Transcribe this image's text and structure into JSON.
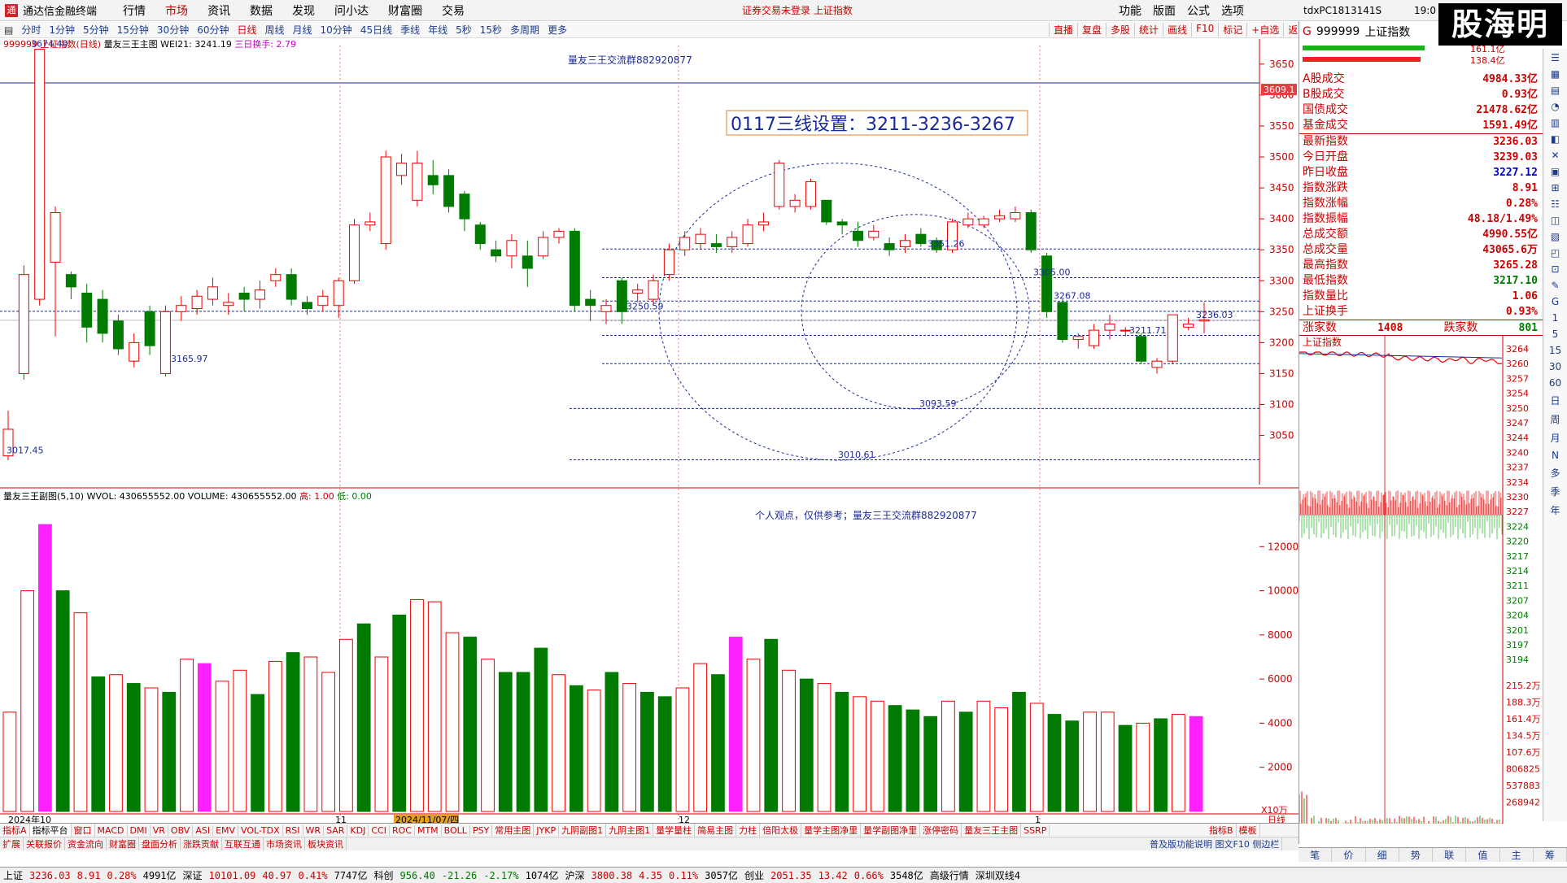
{
  "app": {
    "title": "通达信金融终端",
    "notice": "证券交易未登录  上证指数",
    "pc_name": "tdxPC1813141S",
    "clock": "19:0",
    "brand": "股海明灯"
  },
  "menu": [
    {
      "label": "行情"
    },
    {
      "label": "市场",
      "active": true
    },
    {
      "label": "资讯"
    },
    {
      "label": "数据"
    },
    {
      "label": "发现"
    },
    {
      "label": "问小达"
    },
    {
      "label": "财富圈"
    },
    {
      "label": "交易"
    }
  ],
  "menu_right": [
    "功能",
    "版面",
    "公式",
    "选项"
  ],
  "periods": [
    "分时",
    "1分钟",
    "5分钟",
    "15分钟",
    "30分钟",
    "60分钟",
    "日线",
    "周线",
    "月线",
    "10分钟",
    "45日线",
    "季线",
    "年线",
    "5秒",
    "15秒",
    "多周期",
    "更多"
  ],
  "period_active": "日线",
  "tools": [
    "直播",
    "复盘",
    "多股",
    "统计",
    "画线",
    "F10",
    "标记",
    "+自选",
    "返回"
  ],
  "chart_header": {
    "name": "999999 上证指数(日线)",
    "ind": "量友三王主图",
    "wei": "WEI21: 3241.19",
    "swap": "三日换手: 2.79"
  },
  "annotation_top": "量友三王交流群882920877",
  "boxed_text": "0117三线设置：3211-3236-3267",
  "vol_header": {
    "name": "量友三王副图(5,10)",
    "wvol": "WVOL: 430655552.00",
    "volume": "VOLUME: 430655552.00",
    "high": "高: 1.00",
    "low": "低: 0.00"
  },
  "vol_note": "个人观点，仅供参考；量友三王交流群882920877",
  "price_labels": [
    "3674.40",
    "3017.45",
    "3165.97",
    "3250.59",
    "3351.26",
    "3305.00",
    "3267.08",
    "3211.71",
    "3236.03",
    "3093.59",
    "3010.61"
  ],
  "price_tag": "3609.1",
  "y_ticks": [
    "3650",
    "3600",
    "3550",
    "3500",
    "3450",
    "3400",
    "3350",
    "3300",
    "3250",
    "3200",
    "3150",
    "3100",
    "3050"
  ],
  "vol_ticks": [
    "12000",
    "10000",
    "8000",
    "6000",
    "4000",
    "2000"
  ],
  "vol_unit": "X10万",
  "x_labels": [
    "2024年10",
    "11",
    "2024/11/07/四",
    "12",
    "1"
  ],
  "x_label_right": "日线",
  "chart_data": {
    "type": "candlestick",
    "ylim": [
      3010,
      3680
    ],
    "candles": [
      [
        3017,
        3060,
        3010,
        3090
      ],
      [
        3150,
        3310,
        3140,
        3325
      ],
      [
        3270,
        3674,
        3260,
        3674
      ],
      [
        3330,
        3410,
        3210,
        3420
      ],
      [
        3310,
        3290,
        3270,
        3315
      ],
      [
        3280,
        3225,
        3200,
        3295
      ],
      [
        3270,
        3215,
        3200,
        3285
      ],
      [
        3235,
        3190,
        3180,
        3245
      ],
      [
        3170,
        3200,
        3160,
        3215
      ],
      [
        3250,
        3195,
        3180,
        3260
      ],
      [
        3150,
        3250,
        3145,
        3260
      ],
      [
        3250,
        3260,
        3235,
        3275
      ],
      [
        3255,
        3275,
        3245,
        3285
      ],
      [
        3270,
        3290,
        3260,
        3305
      ],
      [
        3260,
        3265,
        3245,
        3280
      ],
      [
        3280,
        3270,
        3250,
        3290
      ],
      [
        3270,
        3285,
        3255,
        3300
      ],
      [
        3300,
        3310,
        3290,
        3320
      ],
      [
        3310,
        3270,
        3260,
        3320
      ],
      [
        3265,
        3255,
        3245,
        3275
      ],
      [
        3260,
        3275,
        3250,
        3285
      ],
      [
        3260,
        3300,
        3240,
        3305
      ],
      [
        3300,
        3390,
        3295,
        3400
      ],
      [
        3390,
        3395,
        3380,
        3410
      ],
      [
        3360,
        3500,
        3350,
        3510
      ],
      [
        3470,
        3490,
        3455,
        3505
      ],
      [
        3430,
        3490,
        3420,
        3510
      ],
      [
        3470,
        3455,
        3440,
        3495
      ],
      [
        3470,
        3420,
        3410,
        3480
      ],
      [
        3440,
        3400,
        3380,
        3445
      ],
      [
        3390,
        3360,
        3350,
        3395
      ],
      [
        3350,
        3340,
        3330,
        3365
      ],
      [
        3340,
        3365,
        3320,
        3375
      ],
      [
        3340,
        3320,
        3290,
        3365
      ],
      [
        3340,
        3370,
        3335,
        3380
      ],
      [
        3370,
        3380,
        3360,
        3385
      ],
      [
        3380,
        3260,
        3250,
        3385
      ],
      [
        3270,
        3260,
        3235,
        3285
      ],
      [
        3250,
        3260,
        3230,
        3270
      ],
      [
        3300,
        3250,
        3230,
        3305
      ],
      [
        3280,
        3285,
        3265,
        3295
      ],
      [
        3270,
        3300,
        3260,
        3310
      ],
      [
        3310,
        3350,
        3300,
        3360
      ],
      [
        3350,
        3370,
        3340,
        3380
      ],
      [
        3360,
        3375,
        3350,
        3385
      ],
      [
        3360,
        3355,
        3345,
        3375
      ],
      [
        3355,
        3370,
        3345,
        3380
      ],
      [
        3360,
        3390,
        3355,
        3400
      ],
      [
        3390,
        3395,
        3380,
        3410
      ],
      [
        3420,
        3490,
        3415,
        3495
      ],
      [
        3420,
        3430,
        3410,
        3440
      ],
      [
        3420,
        3460,
        3415,
        3465
      ],
      [
        3430,
        3395,
        3390,
        3430
      ],
      [
        3395,
        3390,
        3375,
        3400
      ],
      [
        3380,
        3365,
        3355,
        3395
      ],
      [
        3370,
        3380,
        3365,
        3390
      ],
      [
        3360,
        3350,
        3340,
        3370
      ],
      [
        3355,
        3365,
        3345,
        3375
      ],
      [
        3375,
        3360,
        3355,
        3385
      ],
      [
        3365,
        3350,
        3345,
        3370
      ],
      [
        3350,
        3395,
        3345,
        3400
      ],
      [
        3390,
        3400,
        3385,
        3410
      ],
      [
        3390,
        3400,
        3385,
        3405
      ],
      [
        3400,
        3405,
        3395,
        3415
      ],
      [
        3400,
        3410,
        3395,
        3420
      ],
      [
        3410,
        3350,
        3345,
        3415
      ],
      [
        3340,
        3250,
        3240,
        3345
      ],
      [
        3265,
        3205,
        3200,
        3270
      ],
      [
        3205,
        3210,
        3190,
        3215
      ],
      [
        3195,
        3220,
        3190,
        3230
      ],
      [
        3220,
        3230,
        3205,
        3245
      ],
      [
        3220,
        3220,
        3210,
        3225
      ],
      [
        3210,
        3170,
        3165,
        3215
      ],
      [
        3160,
        3170,
        3150,
        3175
      ],
      [
        3170,
        3245,
        3165,
        3245
      ],
      [
        3225,
        3230,
        3220,
        3240
      ],
      [
        3235,
        3237,
        3215,
        3265
      ]
    ],
    "volume": [
      {
        "v": 4500,
        "c": "r"
      },
      {
        "v": 10000,
        "c": "r"
      },
      {
        "v": 13000,
        "c": "m"
      },
      {
        "v": 10000,
        "c": "g"
      },
      {
        "v": 9000,
        "c": "r"
      },
      {
        "v": 6100,
        "c": "g"
      },
      {
        "v": 6200,
        "c": "r"
      },
      {
        "v": 5800,
        "c": "g"
      },
      {
        "v": 5600,
        "c": "r"
      },
      {
        "v": 5400,
        "c": "g"
      },
      {
        "v": 6900,
        "c": "r"
      },
      {
        "v": 6700,
        "c": "m"
      },
      {
        "v": 5900,
        "c": "r"
      },
      {
        "v": 6400,
        "c": "r"
      },
      {
        "v": 5300,
        "c": "g"
      },
      {
        "v": 6800,
        "c": "r"
      },
      {
        "v": 7200,
        "c": "g"
      },
      {
        "v": 7000,
        "c": "r"
      },
      {
        "v": 6300,
        "c": "r"
      },
      {
        "v": 7800,
        "c": "r"
      },
      {
        "v": 8500,
        "c": "g"
      },
      {
        "v": 7000,
        "c": "r"
      },
      {
        "v": 8900,
        "c": "g"
      },
      {
        "v": 9600,
        "c": "r"
      },
      {
        "v": 9500,
        "c": "r"
      },
      {
        "v": 8100,
        "c": "r"
      },
      {
        "v": 7900,
        "c": "g"
      },
      {
        "v": 6900,
        "c": "r"
      },
      {
        "v": 6300,
        "c": "g"
      },
      {
        "v": 6300,
        "c": "g"
      },
      {
        "v": 7400,
        "c": "g"
      },
      {
        "v": 6200,
        "c": "r"
      },
      {
        "v": 5700,
        "c": "g"
      },
      {
        "v": 5500,
        "c": "r"
      },
      {
        "v": 6300,
        "c": "g"
      },
      {
        "v": 5800,
        "c": "r"
      },
      {
        "v": 5400,
        "c": "g"
      },
      {
        "v": 5200,
        "c": "g"
      },
      {
        "v": 5600,
        "c": "r"
      },
      {
        "v": 6700,
        "c": "r"
      },
      {
        "v": 6200,
        "c": "g"
      },
      {
        "v": 7900,
        "c": "m"
      },
      {
        "v": 6900,
        "c": "r"
      },
      {
        "v": 7800,
        "c": "g"
      },
      {
        "v": 6400,
        "c": "r"
      },
      {
        "v": 6000,
        "c": "g"
      },
      {
        "v": 5800,
        "c": "r"
      },
      {
        "v": 5400,
        "c": "g"
      },
      {
        "v": 5200,
        "c": "r"
      },
      {
        "v": 5000,
        "c": "r"
      },
      {
        "v": 4800,
        "c": "g"
      },
      {
        "v": 4600,
        "c": "g"
      },
      {
        "v": 4300,
        "c": "g"
      },
      {
        "v": 5000,
        "c": "r"
      },
      {
        "v": 4500,
        "c": "g"
      },
      {
        "v": 5000,
        "c": "r"
      },
      {
        "v": 4700,
        "c": "r"
      },
      {
        "v": 5400,
        "c": "g"
      },
      {
        "v": 4900,
        "c": "r"
      },
      {
        "v": 4400,
        "c": "g"
      },
      {
        "v": 4100,
        "c": "g"
      },
      {
        "v": 4500,
        "c": "r"
      },
      {
        "v": 4500,
        "c": "r"
      },
      {
        "v": 3900,
        "c": "g"
      },
      {
        "v": 4000,
        "c": "r"
      },
      {
        "v": 4200,
        "c": "g"
      },
      {
        "v": 4400,
        "c": "r"
      },
      {
        "v": 4300,
        "c": "m"
      }
    ],
    "hlines": [
      3351.26,
      3305.0,
      3267.08,
      3250.59,
      3236.03,
      3211.71,
      3165.97,
      3093.59,
      3010.61
    ]
  },
  "right": {
    "code": "999999",
    "name": "上证指数",
    "g": "G",
    "top_vals": [
      "161.1亿",
      "138.4亿"
    ],
    "rows1": [
      {
        "k": "A股成交",
        "v": "4984.33亿"
      },
      {
        "k": "B股成交",
        "v": "0.93亿"
      },
      {
        "k": "国债成交",
        "v": "21478.62亿"
      },
      {
        "k": "基金成交",
        "v": "1591.49亿"
      }
    ],
    "rows2": [
      {
        "k": "最新指数",
        "v": "3236.03",
        "c": "r"
      },
      {
        "k": "今日开盘",
        "v": "3239.03",
        "c": "r"
      },
      {
        "k": "昨日收盘",
        "v": "3227.12",
        "c": "blue"
      },
      {
        "k": "指数涨跌",
        "v": "8.91",
        "c": "r"
      },
      {
        "k": "指数涨幅",
        "v": "0.28%",
        "c": "r"
      },
      {
        "k": "指数振幅",
        "v": "48.18/1.49%",
        "c": "r"
      },
      {
        "k": "总成交额",
        "v": "4990.55亿",
        "c": "r"
      },
      {
        "k": "总成交量",
        "v": "43065.6万",
        "c": "r"
      },
      {
        "k": "最高指数",
        "v": "3265.28",
        "c": "r"
      },
      {
        "k": "最低指数",
        "v": "3217.10",
        "c": "gr"
      },
      {
        "k": "指数量比",
        "v": "1.06",
        "c": "r"
      },
      {
        "k": "上证换手",
        "v": "0.93%",
        "c": "r"
      }
    ],
    "updown": {
      "up_label": "涨家数",
      "up": "1408",
      "down_label": "跌家数",
      "down": "801"
    },
    "mini_title": "上证指数",
    "mini_ticks": [
      "3264",
      "3260",
      "3257",
      "3254",
      "3250",
      "3247",
      "3244",
      "3240",
      "3237",
      "3234",
      "3230",
      "3227",
      "3224",
      "3220",
      "3217",
      "3214",
      "3211",
      "3207",
      "3204",
      "3201",
      "3197",
      "3194"
    ],
    "mini_vol_ticks": [
      "215.2万",
      "188.3万",
      "161.4万",
      "134.5万",
      "107.6万",
      "806825",
      "537883",
      "268942"
    ],
    "tabs": [
      "笔",
      "价",
      "细",
      "势",
      "联",
      "值",
      "主",
      "筹"
    ]
  },
  "sidebar": [
    "G",
    "1",
    "5",
    "15",
    "30",
    "60",
    "日",
    "周",
    "月",
    "N",
    "多",
    "季",
    "年"
  ],
  "indicators": [
    "指标A",
    "指标平台",
    "窗口",
    "MACD",
    "DMI",
    "VR",
    "OBV",
    "ASI",
    "EMV",
    "VOL-TDX",
    "RSI",
    "WR",
    "SAR",
    "KDJ",
    "CCI",
    "ROC",
    "MTM",
    "BOLL",
    "PSY",
    "常用主图",
    "JYKP",
    "九阴副图1",
    "九阴主图1",
    "量学量柱",
    "简易主图",
    "力柱",
    "倍阳太极",
    "量学主图净里",
    "量学副图净里",
    "涨停密码",
    "量友三王主图",
    "SSRP"
  ],
  "ind_right": [
    "指标B",
    "模板"
  ],
  "ext": [
    "扩展",
    "关联报价",
    "资金流向",
    "财富圈",
    "盘面分析",
    "涨跌贡献",
    "互联互通",
    "市场资讯",
    "板块资讯"
  ],
  "ext_right": "普及版功能说明 图文F10 侧边栏",
  "status": [
    {
      "t": "上证",
      "c": "b"
    },
    {
      "t": "3236.03",
      "c": "r"
    },
    {
      "t": "8.91",
      "c": "r"
    },
    {
      "t": "0.28%",
      "c": "r"
    },
    {
      "t": "4991亿",
      "c": "b"
    },
    {
      "t": "深证",
      "c": "b"
    },
    {
      "t": "10101.09",
      "c": "r"
    },
    {
      "t": "40.97",
      "c": "r"
    },
    {
      "t": "0.41%",
      "c": "r"
    },
    {
      "t": "7747亿",
      "c": "b"
    },
    {
      "t": "科创",
      "c": "b"
    },
    {
      "t": "956.40",
      "c": "gr"
    },
    {
      "t": "-21.26",
      "c": "gr"
    },
    {
      "t": "-2.17%",
      "c": "gr"
    },
    {
      "t": "1074亿",
      "c": "b"
    },
    {
      "t": "沪深",
      "c": "b"
    },
    {
      "t": "3800.38",
      "c": "r"
    },
    {
      "t": "4.35",
      "c": "r"
    },
    {
      "t": "0.11%",
      "c": "r"
    },
    {
      "t": "3057亿",
      "c": "b"
    },
    {
      "t": "创业",
      "c": "b"
    },
    {
      "t": "2051.35",
      "c": "r"
    },
    {
      "t": "13.42",
      "c": "r"
    },
    {
      "t": "0.66%",
      "c": "r"
    },
    {
      "t": "3548亿",
      "c": "b"
    },
    {
      "t": "高级行情",
      "c": "b"
    },
    {
      "t": "深圳双线4",
      "c": "b"
    }
  ]
}
